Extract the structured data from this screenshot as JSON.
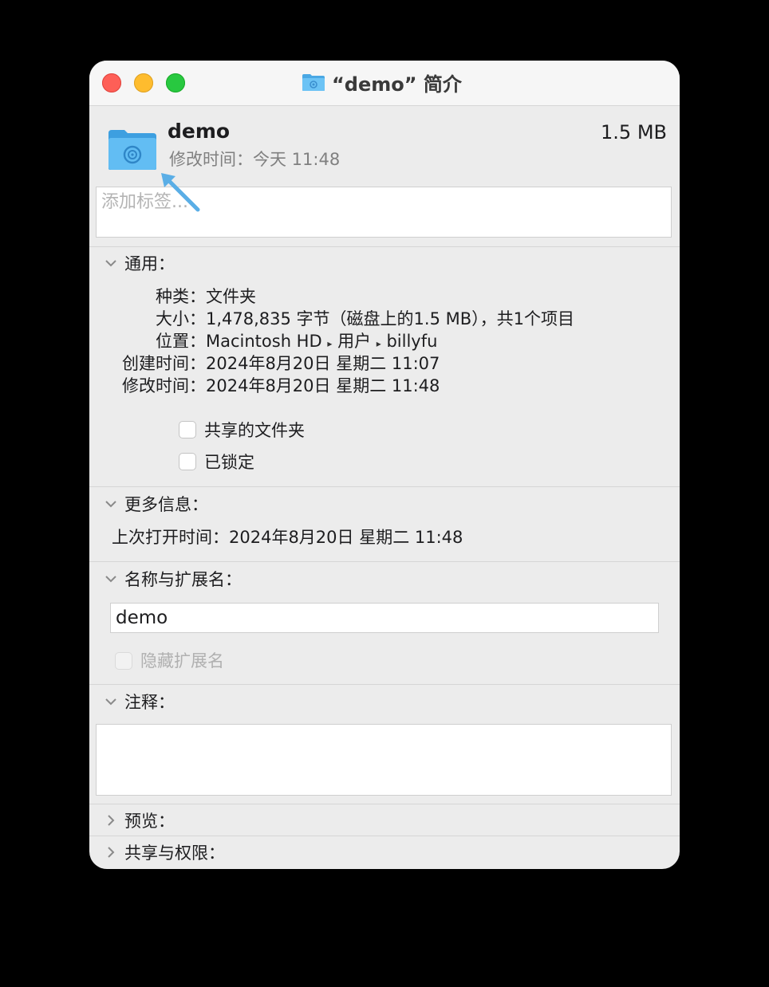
{
  "window": {
    "title": "“demo” 简介",
    "colors": {
      "close": "#fe5f57",
      "minimize": "#febc2e",
      "zoom": "#28c840",
      "folder": "#5bb6ee"
    }
  },
  "header": {
    "name": "demo",
    "size": "1.5 MB",
    "modified": "修改时间：今天 11:48",
    "tags_placeholder": "添加标签..."
  },
  "general": {
    "heading": "通用：",
    "kind_label": "种类：",
    "kind_value": "文件夹",
    "size_label": "大小：",
    "size_value": "1,478,835 字节（磁盘上的1.5 MB），共1个项目",
    "where_label": "位置：",
    "where_parts": [
      "Macintosh HD",
      "用户",
      "billyfu"
    ],
    "where_sep": "▸",
    "created_label": "创建时间：",
    "created_value": "2024年8月20日 星期二 11:07",
    "modified_label": "修改时间：",
    "modified_value": "2024年8月20日 星期二 11:48",
    "shared_folder": "共享的文件夹",
    "locked": "已锁定"
  },
  "more_info": {
    "heading": "更多信息：",
    "last_opened_label": "上次打开时间：",
    "last_opened_value": "2024年8月20日 星期二 11:48"
  },
  "name_ext": {
    "heading": "名称与扩展名：",
    "name_value": "demo",
    "hide_extension": "隐藏扩展名"
  },
  "comments": {
    "heading": "注释："
  },
  "preview": {
    "heading": "预览："
  },
  "sharing": {
    "heading": "共享与权限："
  }
}
